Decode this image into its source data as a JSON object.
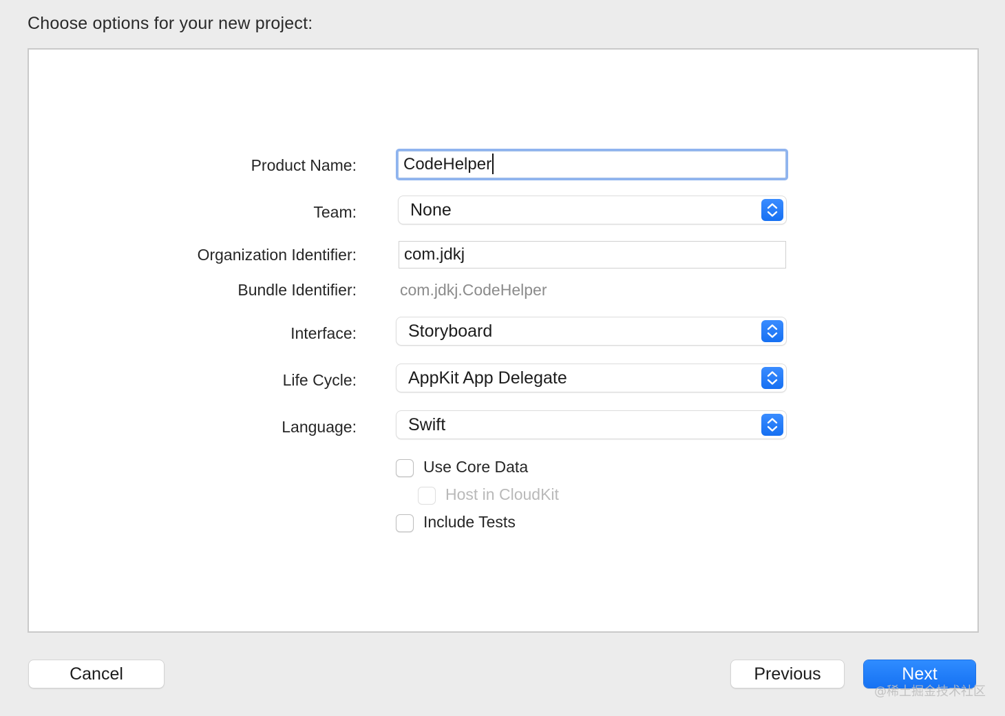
{
  "header": {
    "title": "Choose options for your new project:"
  },
  "form": {
    "product_name": {
      "label": "Product Name:",
      "value": "CodeHelper"
    },
    "team": {
      "label": "Team:",
      "value": "None"
    },
    "organization_identifier": {
      "label": "Organization Identifier:",
      "value": "com.jdkj"
    },
    "bundle_identifier": {
      "label": "Bundle Identifier:",
      "value": "com.jdkj.CodeHelper"
    },
    "interface": {
      "label": "Interface:",
      "value": "Storyboard"
    },
    "life_cycle": {
      "label": "Life Cycle:",
      "value": "AppKit App Delegate"
    },
    "language": {
      "label": "Language:",
      "value": "Swift"
    },
    "checkboxes": {
      "use_core_data": {
        "label": "Use Core Data",
        "checked": false,
        "enabled": true
      },
      "host_in_cloudkit": {
        "label": "Host in CloudKit",
        "checked": false,
        "enabled": false
      },
      "include_tests": {
        "label": "Include Tests",
        "checked": false,
        "enabled": true
      }
    }
  },
  "footer": {
    "cancel_label": "Cancel",
    "previous_label": "Previous",
    "next_label": "Next"
  },
  "watermark": "@稀土掘金技术社区",
  "colors": {
    "accent": "#1672f3",
    "focus_ring": "#8fb4ef"
  }
}
